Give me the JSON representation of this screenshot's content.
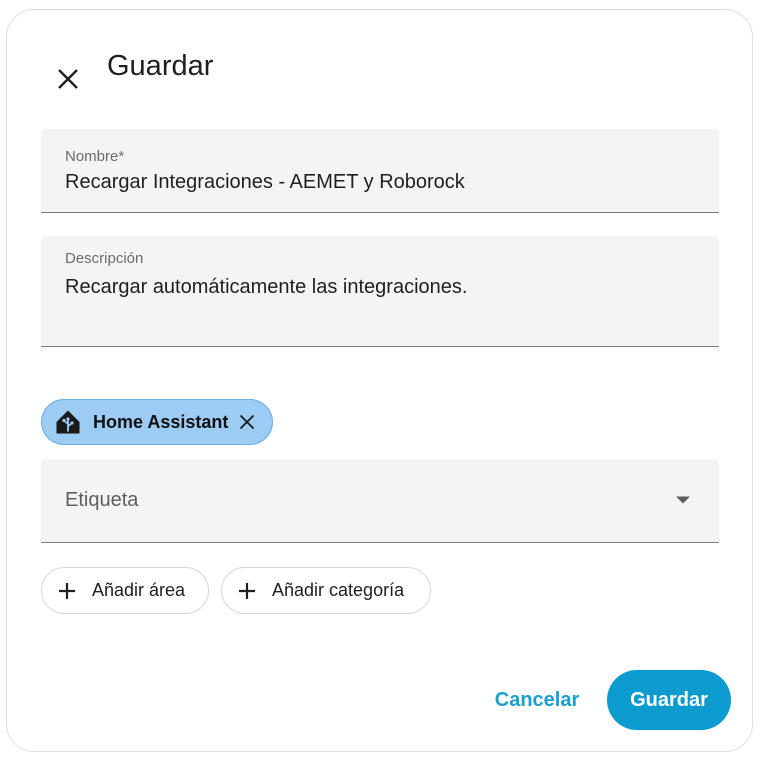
{
  "dialog": {
    "title": "Guardar",
    "close_icon": "close-icon"
  },
  "fields": {
    "name": {
      "label": "Nombre*",
      "value": "Recargar Integraciones - AEMET y Roborock"
    },
    "description": {
      "label": "Descripción",
      "value": "Recargar automáticamente las integraciones."
    }
  },
  "label_chip": {
    "text": "Home Assistant",
    "icon": "home-assistant-icon",
    "remove_icon": "close-icon",
    "color": "#9ccbf3"
  },
  "label_select": {
    "placeholder": "Etiqueta",
    "icon": "chevron-down-icon"
  },
  "add_buttons": {
    "area": "Añadir área",
    "category": "Añadir categoría",
    "icon": "plus-icon"
  },
  "actions": {
    "cancel": "Cancelar",
    "save": "Guardar",
    "accent_color": "#0b9bcf"
  }
}
